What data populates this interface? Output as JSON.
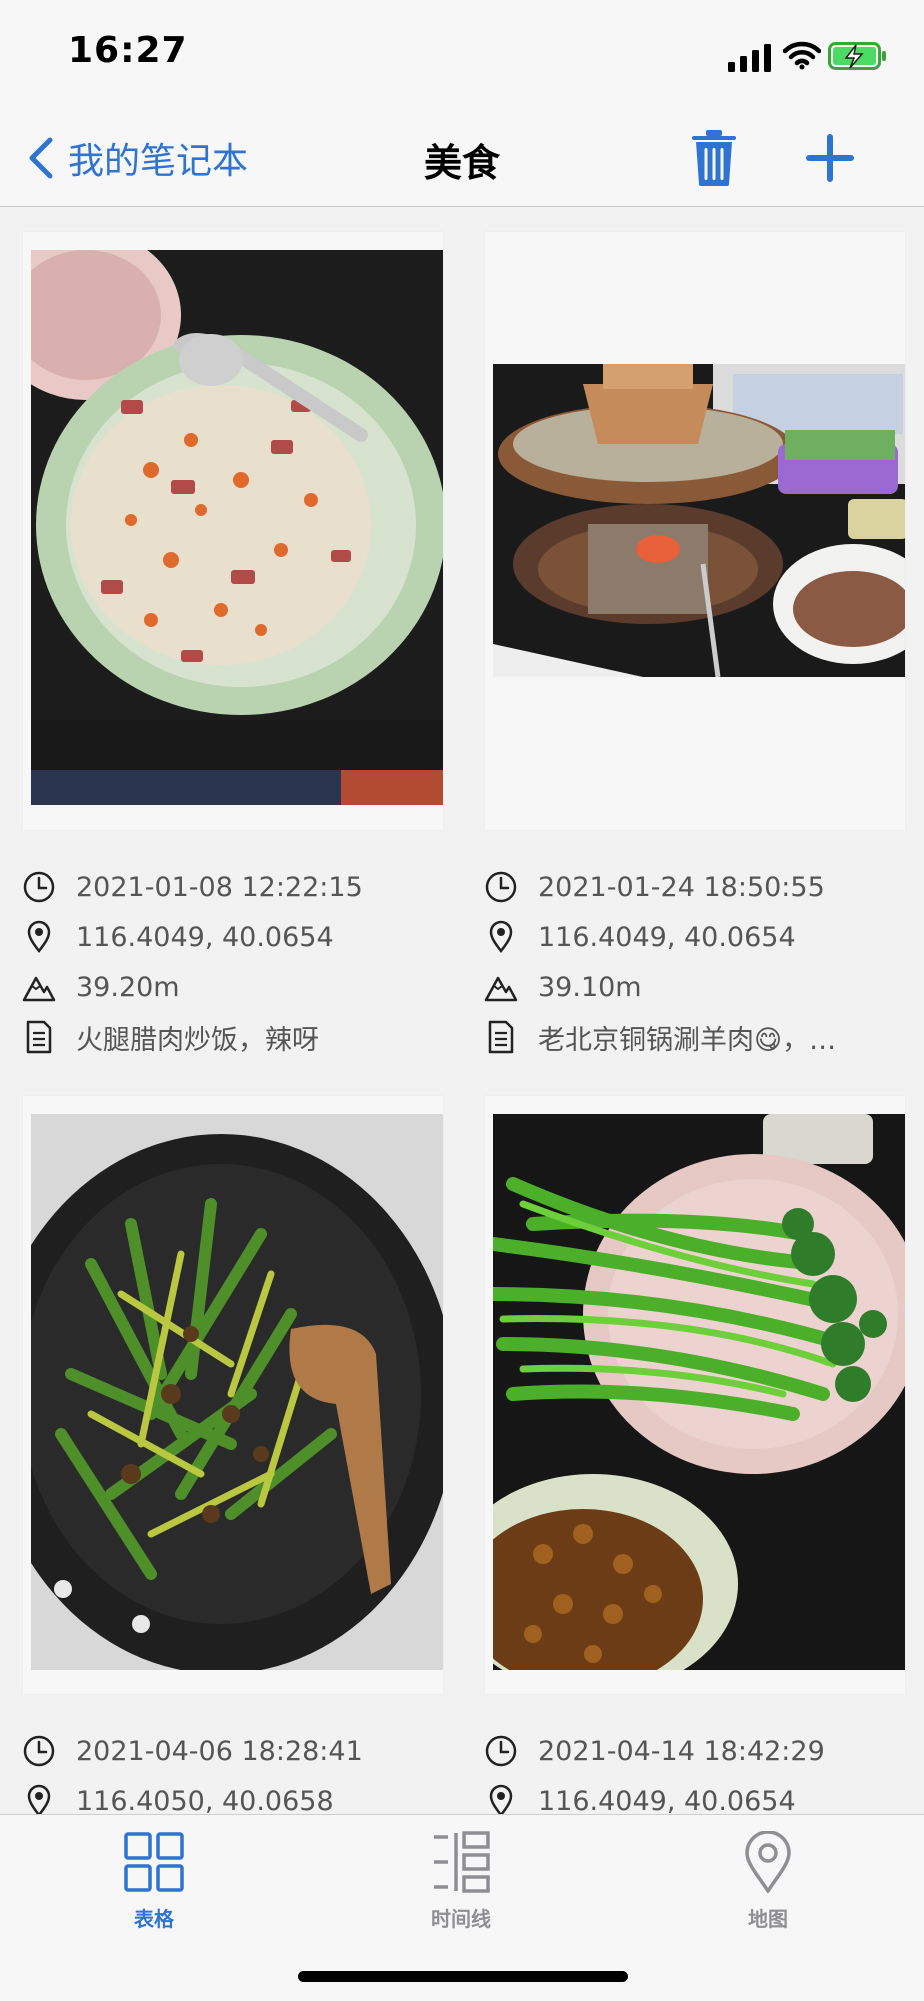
{
  "status_bar": {
    "time": "16:27"
  },
  "nav": {
    "back_label": "我的笔记本",
    "title": "美食"
  },
  "colors": {
    "accent": "#2f74d0",
    "inactive": "#8e8e93"
  },
  "notes": [
    {
      "time": "2021-01-08 12:22:15",
      "location": "116.4049, 40.0654",
      "altitude": "39.20m",
      "text": "火腿腊肉炒饭，辣呀",
      "photo": "fried rice with ham and cured pork"
    },
    {
      "time": "2021-01-24 18:50:55",
      "location": "116.4049, 40.0654",
      "altitude": "39.10m",
      "text": "老北京铜锅涮羊肉😋，…",
      "photo": "copper hotpot"
    },
    {
      "time": "2021-04-06 18:28:41",
      "location": "116.4050, 40.0658",
      "altitude": "",
      "text": "",
      "photo": "stir-fried leeks in wok"
    },
    {
      "time": "2021-04-14 18:42:29",
      "location": "116.4049, 40.0654",
      "altitude": "",
      "text": "",
      "photo": "green vegetables and shrimp"
    }
  ],
  "tabs": [
    {
      "label": "表格",
      "icon": "grid-icon",
      "active": true
    },
    {
      "label": "时间线",
      "icon": "timeline-icon",
      "active": false
    },
    {
      "label": "地图",
      "icon": "map-pin-icon",
      "active": false
    }
  ]
}
